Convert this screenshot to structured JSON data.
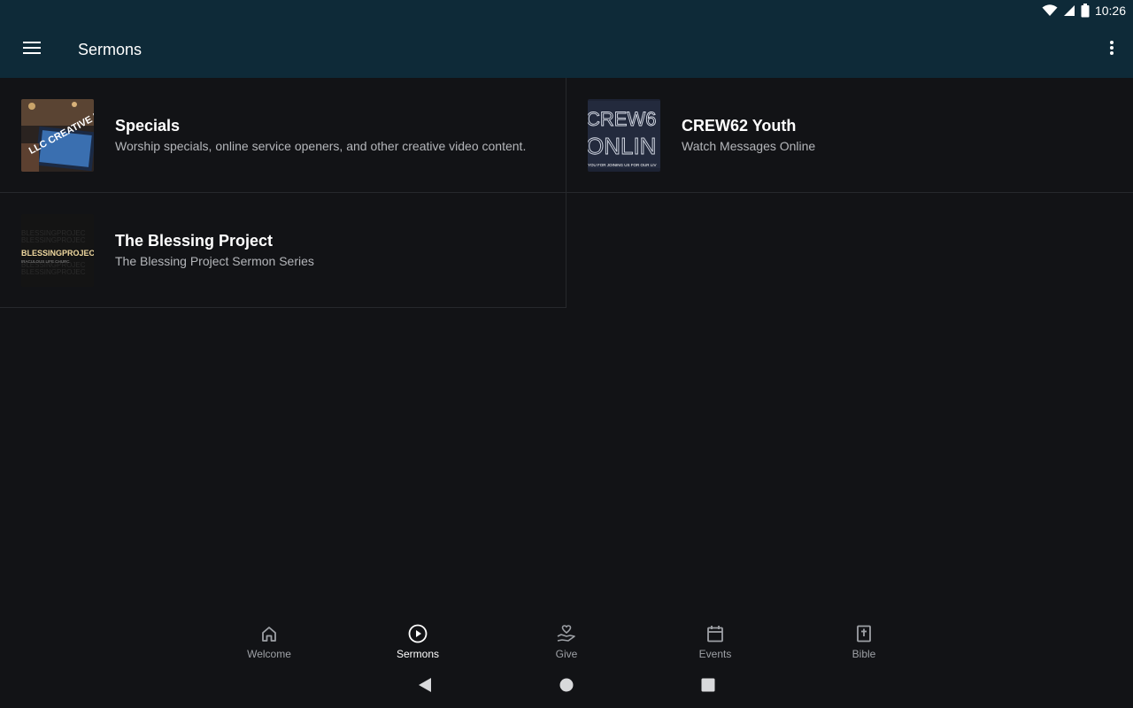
{
  "status": {
    "time": "10:26"
  },
  "appbar": {
    "title": "Sermons"
  },
  "series": [
    {
      "title": "Specials",
      "subtitle": "Worship specials, online service openers, and other creative video content.",
      "thumb_text": "LLC CREATIVE MEDIA"
    },
    {
      "title": "CREW62 Youth",
      "subtitle": "Watch Messages Online",
      "thumb_text_1": "CREW6",
      "thumb_text_2": "ONLIN",
      "thumb_text_3": "YOU FOR JOINING US FOR OUR LIV"
    },
    {
      "title": "The Blessing Project",
      "subtitle": "The Blessing Project Sermon Series",
      "thumb_text": "BLESSINGPROJEC",
      "thumb_text_small": "IRACULOUS LIFE CHURC"
    }
  ],
  "nav": [
    {
      "label": "Welcome",
      "icon": "home-icon",
      "active": false
    },
    {
      "label": "Sermons",
      "icon": "play-circle-icon",
      "active": true
    },
    {
      "label": "Give",
      "icon": "give-hand-heart-icon",
      "active": false
    },
    {
      "label": "Events",
      "icon": "calendar-icon",
      "active": false
    },
    {
      "label": "Bible",
      "icon": "bible-icon",
      "active": false
    }
  ],
  "colors": {
    "appbar": "#0e2a38",
    "background": "#121316",
    "divider": "#26282c",
    "inactive": "#9ea1a6"
  }
}
